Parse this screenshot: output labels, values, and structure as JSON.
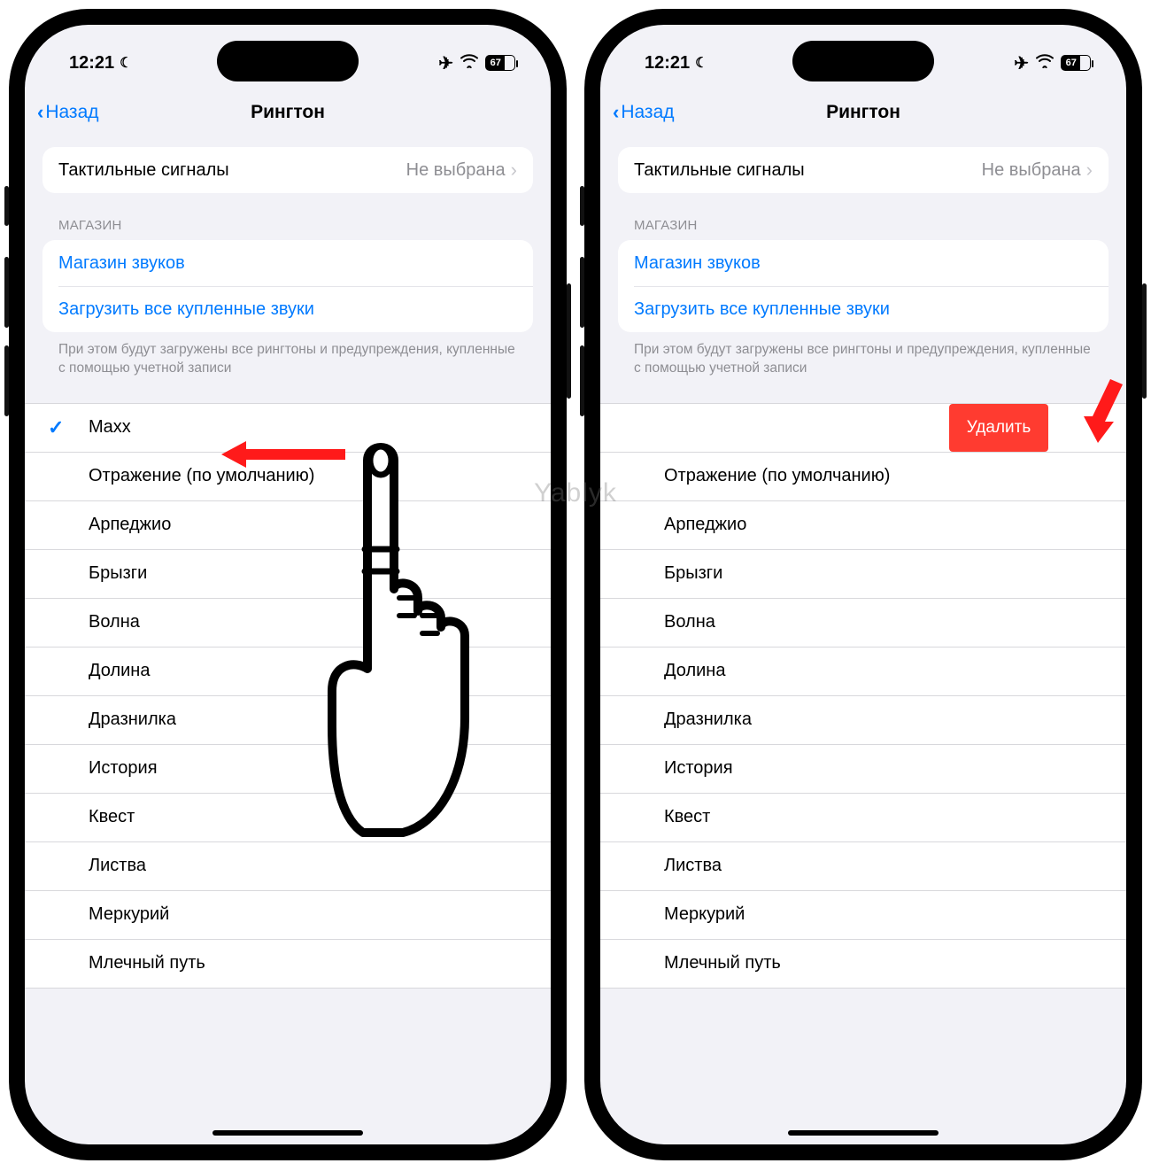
{
  "status": {
    "time": "12:21",
    "battery_pct": "67"
  },
  "nav": {
    "back": "Назад",
    "title": "Рингтон"
  },
  "haptics_row": {
    "label": "Тактильные сигналы",
    "value": "Не выбрана"
  },
  "store_section": {
    "header": "МАГАЗИН",
    "tone_store": "Магазин звуков",
    "download_all": "Загрузить все купленные звуки",
    "footer": "При этом будут загружены все рингтоны и предупреждения, купленные с помощью учетной записи"
  },
  "ringtones": {
    "selected": "Maxx",
    "swiped_partial": "axx",
    "delete_label": "Удалить",
    "items": [
      "Отражение (по умолчанию)",
      "Арпеджио",
      "Брызги",
      "Волна",
      "Долина",
      "Дразнилка",
      "История",
      "Квест",
      "Листва",
      "Меркурий",
      "Млечный путь"
    ]
  },
  "watermark": "Yablyk"
}
